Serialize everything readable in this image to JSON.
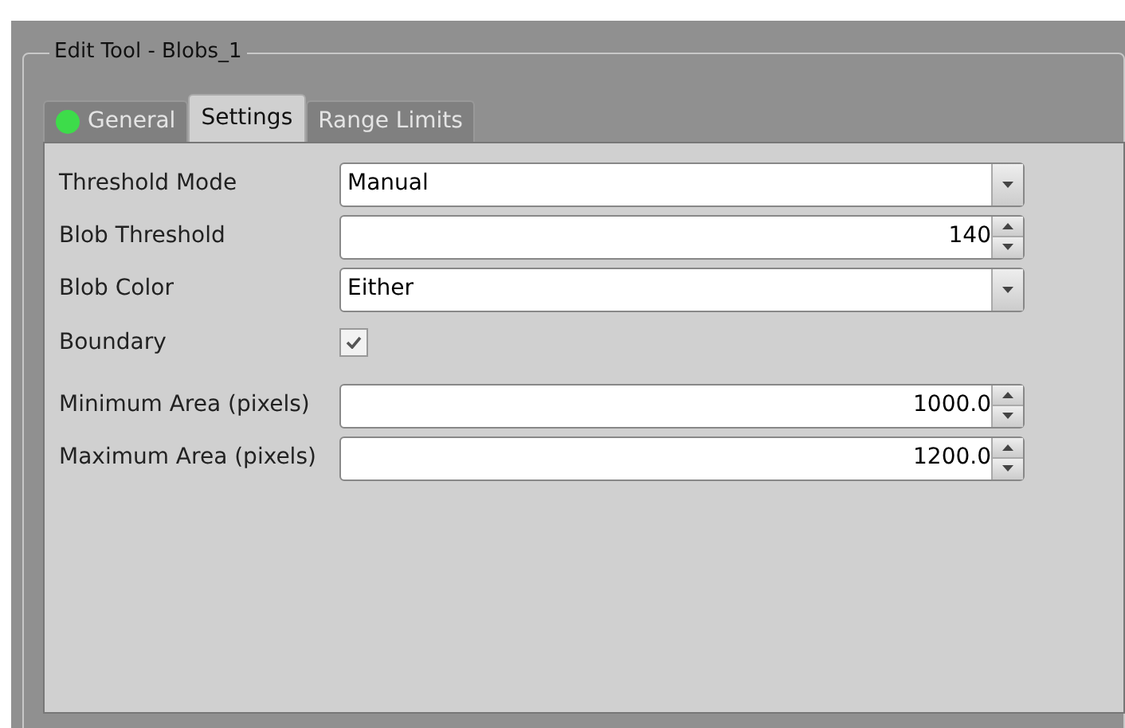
{
  "group": {
    "title": "Edit Tool - Blobs_1"
  },
  "tabs": [
    {
      "label": "General",
      "selected": false,
      "color": "#3ddc4a"
    },
    {
      "label": "Settings",
      "selected": true
    },
    {
      "label": "Range Limits",
      "selected": false
    }
  ],
  "fields": [
    {
      "label": "Threshold Mode",
      "kind": "dropdown",
      "value": "Manual"
    },
    {
      "label": "Blob Threshold",
      "kind": "spin",
      "value": "140"
    },
    {
      "label": "Blob Color",
      "kind": "dropdown",
      "value": "Either"
    },
    {
      "label": "Boundary",
      "kind": "checkbox",
      "checked": true
    },
    {
      "label": "Minimum Area (pixels)",
      "kind": "spin",
      "value": "1000.0"
    },
    {
      "label": "Maximum Area (pixels)",
      "kind": "spin",
      "value": "1200.0"
    }
  ]
}
